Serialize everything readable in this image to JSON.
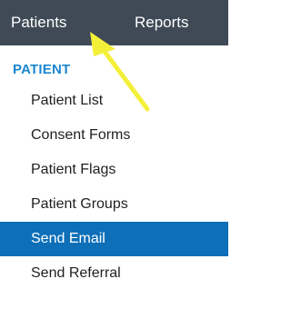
{
  "topbar": {
    "tabs": [
      {
        "label": "Patients"
      },
      {
        "label": "Reports"
      }
    ]
  },
  "menu": {
    "section_header": "PATIENT",
    "items": [
      {
        "label": "Patient List",
        "active": false
      },
      {
        "label": "Consent Forms",
        "active": false
      },
      {
        "label": "Patient Flags",
        "active": false
      },
      {
        "label": "Patient Groups",
        "active": false
      },
      {
        "label": "Send Email",
        "active": true
      },
      {
        "label": "Send Referral",
        "active": false
      }
    ]
  },
  "colors": {
    "topbar_bg": "#3f4a56",
    "section_header": "#1a86d0",
    "active_bg": "#0d6fb8",
    "annotation_arrow": "#f4f03a"
  },
  "icons": {
    "annotation": "arrow-icon"
  }
}
